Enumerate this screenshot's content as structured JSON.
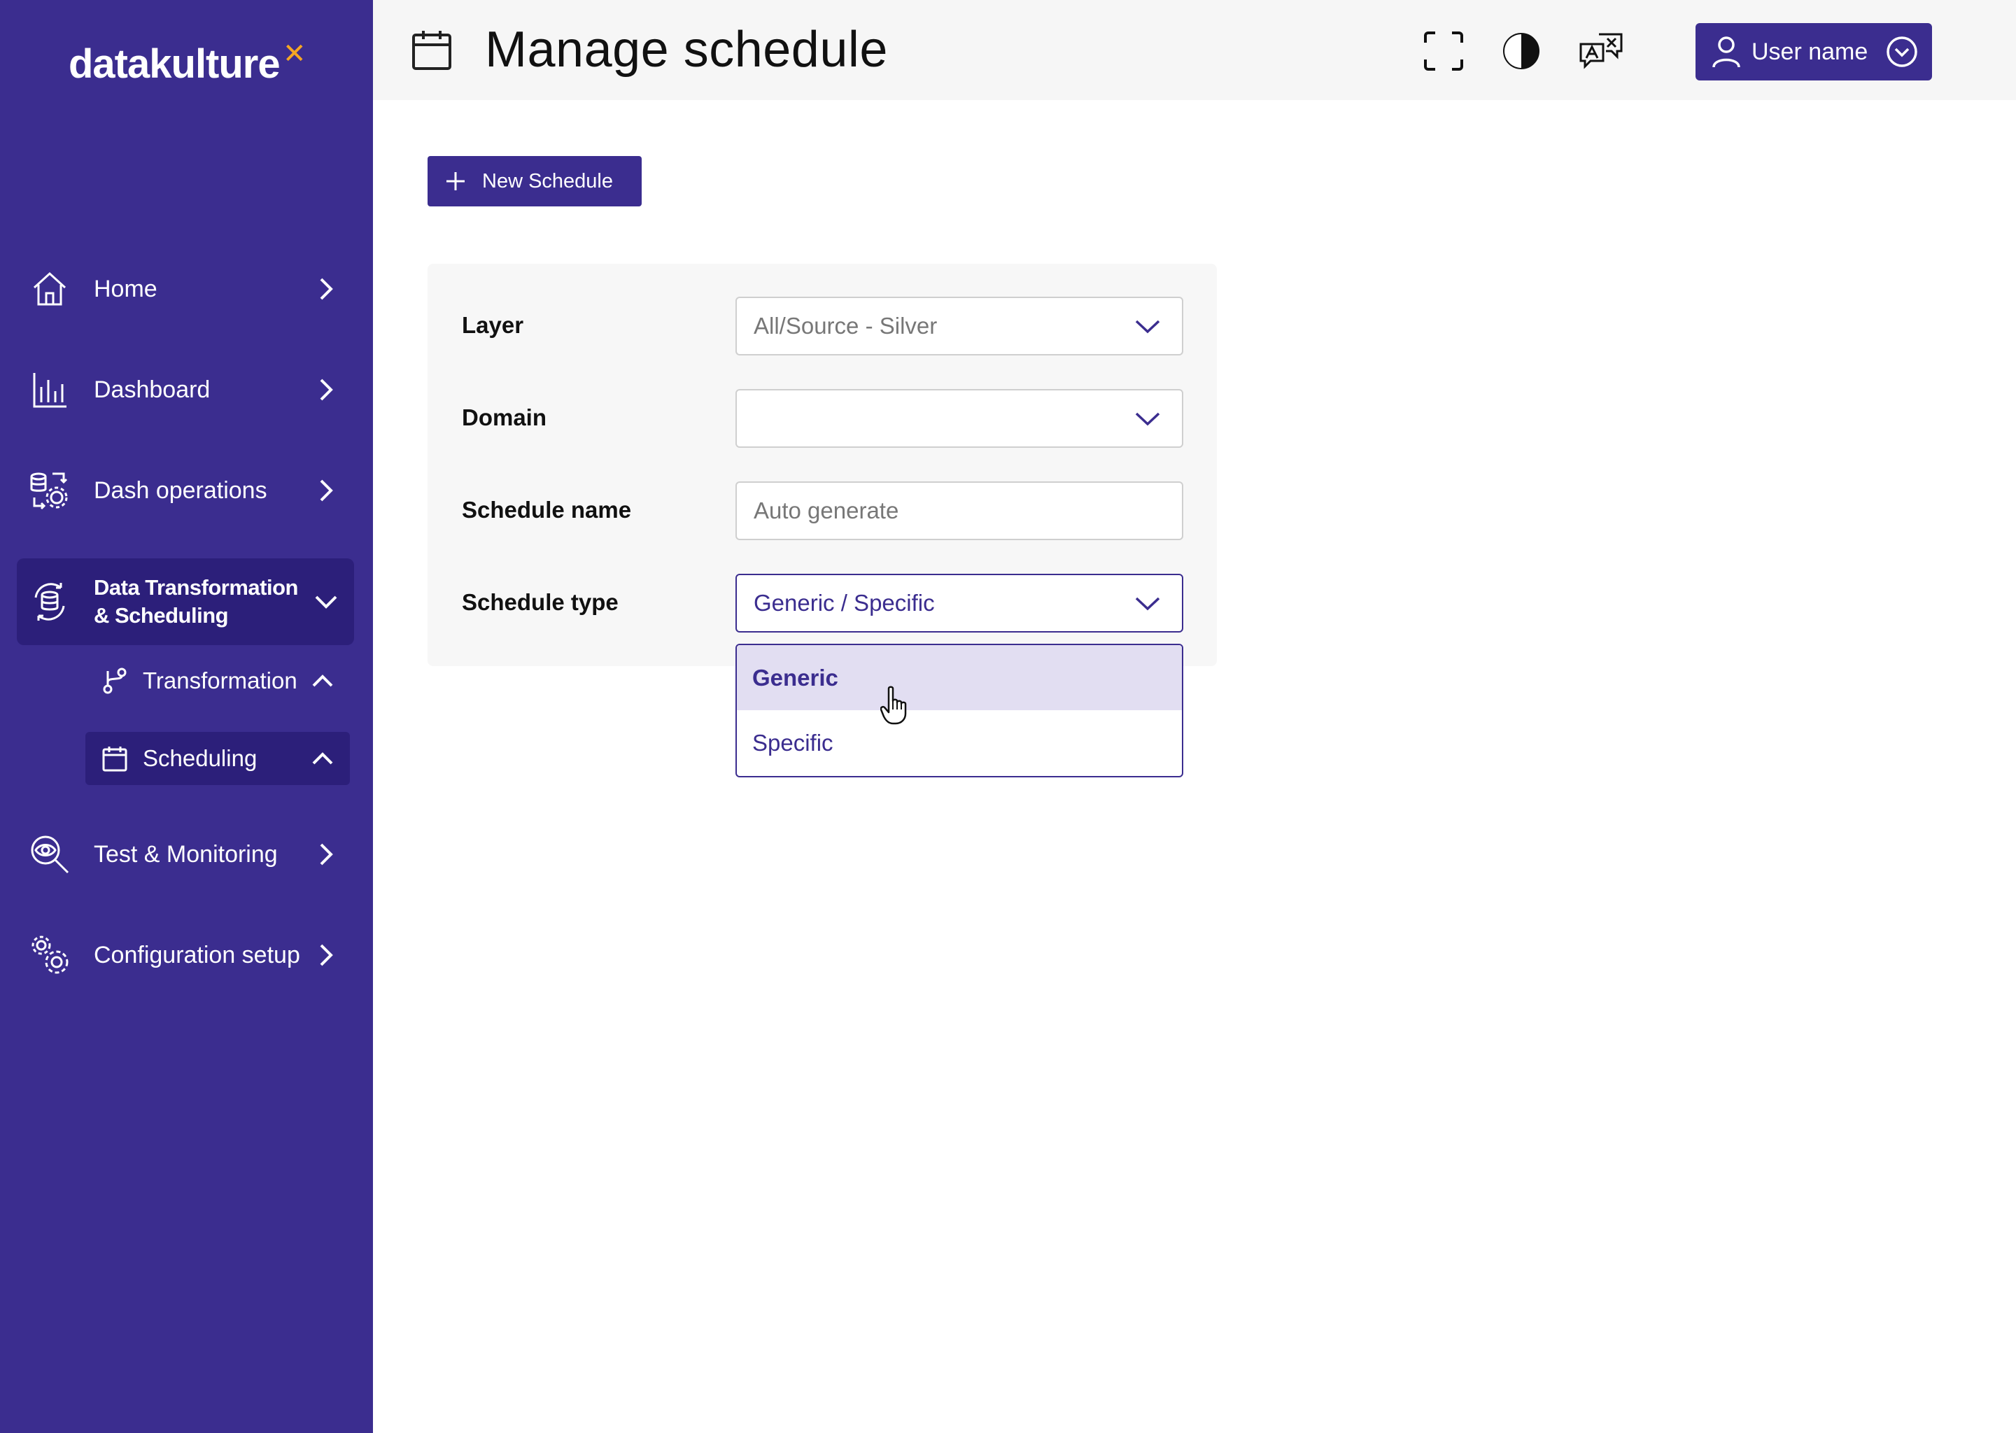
{
  "brand": {
    "logo_text": "datakulture",
    "logo_mark": "✕",
    "accent": "#3b2d8f",
    "accent_dark": "#2c1f7a",
    "logo_accent": "#f5a623"
  },
  "sidebar": {
    "items": [
      {
        "label": "Home",
        "icon": "home-icon"
      },
      {
        "label": "Dashboard",
        "icon": "bar-chart-icon"
      },
      {
        "label": "Dash operations",
        "icon": "database-gear-icon"
      },
      {
        "label": "Data Transformation & Scheduling",
        "icon": "data-sync-icon",
        "expanded": true
      },
      {
        "label": "Test & Monitoring",
        "icon": "eye-search-icon"
      },
      {
        "label": "Configuration setup",
        "icon": "gears-icon"
      }
    ],
    "subitems": [
      {
        "label": "Transformation",
        "icon": "branch-icon"
      },
      {
        "label": "Scheduling",
        "icon": "calendar-icon",
        "active": true
      }
    ]
  },
  "header": {
    "title": "Manage schedule",
    "title_icon": "calendar-icon",
    "actions": [
      "fullscreen-icon",
      "contrast-icon",
      "translate-icon"
    ],
    "user_label": "User name"
  },
  "main": {
    "new_button_label": "New Schedule",
    "form": {
      "layer_label": "Layer",
      "layer_value": "All/Source - Silver",
      "domain_label": "Domain",
      "domain_value": "",
      "schedule_name_label": "Schedule name",
      "schedule_name_placeholder": "Auto generate",
      "schedule_type_label": "Schedule type",
      "schedule_type_value": "Generic / Specific"
    },
    "schedule_type_options": [
      "Generic",
      "Specific"
    ],
    "hovered_option": "Generic"
  }
}
